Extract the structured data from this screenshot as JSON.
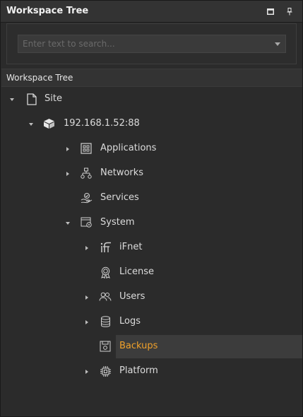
{
  "panel": {
    "title": "Workspace Tree",
    "maximize_icon": "maximize-icon",
    "pin_icon": "pin-icon"
  },
  "search": {
    "placeholder": "Enter text to search...",
    "value": ""
  },
  "tree": {
    "header": "Workspace Tree",
    "nodes": {
      "site": {
        "label": "Site",
        "icon": "page-icon",
        "expanded": true
      },
      "server": {
        "label": "192.168.1.52:88",
        "icon": "server-icon",
        "expanded": true
      },
      "applications": {
        "label": "Applications",
        "icon": "applications-icon",
        "expanded": false
      },
      "networks": {
        "label": "Networks",
        "icon": "network-icon",
        "expanded": false
      },
      "services": {
        "label": "Services",
        "icon": "services-icon"
      },
      "system": {
        "label": "System",
        "icon": "system-icon",
        "expanded": true
      },
      "ifnet": {
        "label": "iFnet",
        "icon": "ifnet-icon",
        "expanded": false
      },
      "license": {
        "label": "License",
        "icon": "license-icon"
      },
      "users": {
        "label": "Users",
        "icon": "users-icon",
        "expanded": false
      },
      "logs": {
        "label": "Logs",
        "icon": "database-icon",
        "expanded": false
      },
      "backups": {
        "label": "Backups",
        "icon": "backup-icon",
        "selected": true
      },
      "platform": {
        "label": "Platform",
        "icon": "chip-icon",
        "expanded": false
      }
    }
  },
  "colors": {
    "panel_bg": "#2b2b2b",
    "header_bg": "#333333",
    "selected_row": "#3c3c3c",
    "active_text": "#f0a12a",
    "text": "#dcdcdc"
  }
}
